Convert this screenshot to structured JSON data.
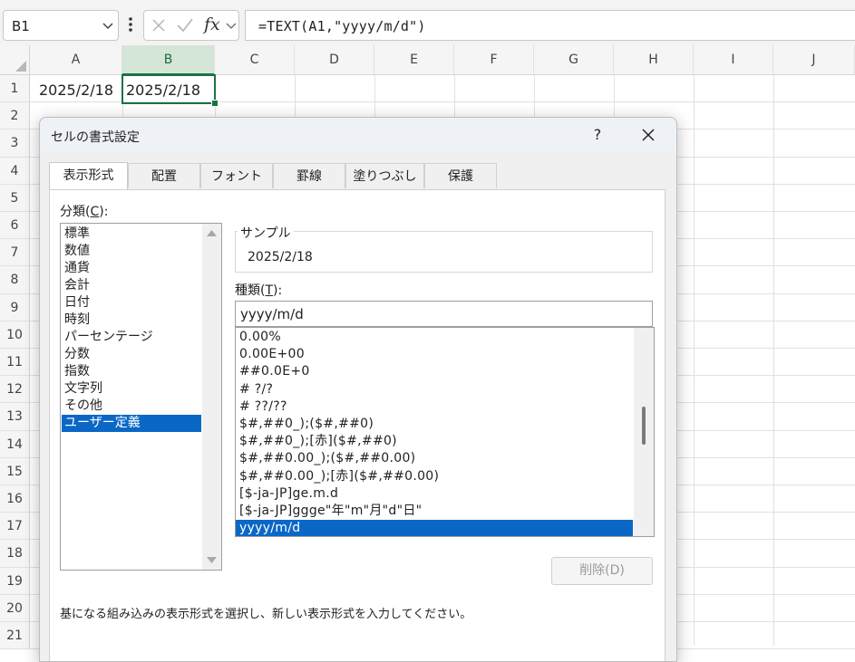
{
  "formula_bar": {
    "name_box": "B1",
    "fx": "fx",
    "formula": "=TEXT(A1,\"yyyy/m/d\")"
  },
  "sheet": {
    "columns": [
      "A",
      "B",
      "C",
      "D",
      "E",
      "F",
      "G",
      "H",
      "I",
      "J"
    ],
    "selected_column": "B",
    "rows": [
      "1",
      "2",
      "3",
      "4",
      "5",
      "6",
      "7",
      "8",
      "9",
      "10",
      "11",
      "12",
      "13",
      "14",
      "15",
      "16",
      "17",
      "18",
      "19",
      "20",
      "21"
    ],
    "cells": {
      "A1": "2025/2/18",
      "B1": "2025/2/18"
    }
  },
  "dialog": {
    "title": "セルの書式設定",
    "help": "?",
    "tabs": [
      "表示形式",
      "配置",
      "フォント",
      "罫線",
      "塗りつぶし",
      "保護"
    ],
    "active_tab": "表示形式",
    "category_label": "分類(",
    "category_label_key": "C",
    "category_label_end": "):",
    "categories": [
      "標準",
      "数値",
      "通貨",
      "会計",
      "日付",
      "時刻",
      "パーセンテージ",
      "分数",
      "指数",
      "文字列",
      "その他",
      "ユーザー定義"
    ],
    "selected_category": "ユーザー定義",
    "sample_label": "サンプル",
    "sample_value": "2025/2/18",
    "type_label": "種類(",
    "type_label_key": "T",
    "type_label_end": "):",
    "type_value": "yyyy/m/d",
    "formats": [
      "0.00%",
      "0.00E+00",
      "##0.0E+0",
      "# ?/?",
      "# ??/??",
      "$#,##0_);($#,##0)",
      "$#,##0_);[赤]($#,##0)",
      "$#,##0.00_);($#,##0.00)",
      "$#,##0.00_);[赤]($#,##0.00)",
      "[$-ja-JP]ge.m.d",
      "[$-ja-JP]ggge\"年\"m\"月\"d\"日\"",
      "yyyy/m/d"
    ],
    "selected_format": "yyyy/m/d",
    "delete_button": "削除(D)",
    "hint": "基になる組み込みの表示形式を選択し、新しい表示形式を入力してください。"
  },
  "colors": {
    "accent_green": "#1e7145",
    "selection_blue": "#0a67c6"
  },
  "icons": [
    "chevron-down-icon",
    "more-icon",
    "cancel-icon",
    "enter-check-icon",
    "function-icon",
    "close-icon",
    "scroll-up-arrow-icon",
    "scroll-down-arrow-icon"
  ]
}
